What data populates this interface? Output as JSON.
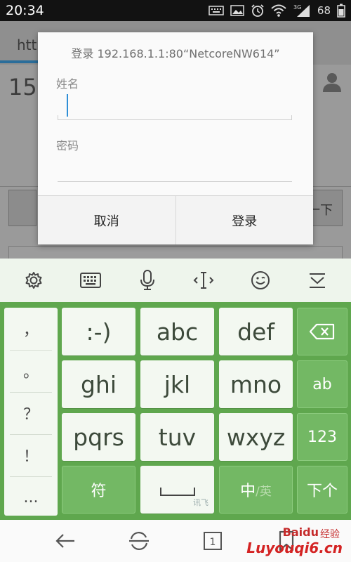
{
  "status_bar": {
    "time": "20:34",
    "battery": "68",
    "network_label": "3G",
    "icons": [
      "keyboard-icon",
      "image-icon",
      "alarm-icon",
      "wifi-icon",
      "signal-icon",
      "battery-icon"
    ]
  },
  "background_page": {
    "tab_text": "http",
    "number_text": "15",
    "button_text": "一下"
  },
  "dialog": {
    "title": "登录 192.168.1.1:80“NetcoreNW614”",
    "name_label": "姓名",
    "name_value": "",
    "password_label": "密码",
    "password_value": "",
    "cancel_label": "取消",
    "login_label": "登录"
  },
  "keyboard_toolbar": {
    "icons": [
      "settings-icon",
      "keyboard-icon",
      "microphone-icon",
      "cursor-icon",
      "emoji-icon",
      "hide-keyboard-icon"
    ]
  },
  "keyboard": {
    "symbols": [
      "，",
      "。",
      "？",
      "！",
      "..."
    ],
    "keys": {
      "smiley": ":-)",
      "abc": "abc",
      "def": "def",
      "ghi": "ghi",
      "jkl": "jkl",
      "mno": "mno",
      "pqrs": "pqrs",
      "tuv": "tuv",
      "wxyz": "wxyz",
      "ab": "ab",
      "num": "123",
      "symbol": "符",
      "cn": "中",
      "en": "英",
      "next": "下个",
      "space_brand": "讯飞"
    }
  },
  "nav_bar": {
    "icons": [
      "back-icon",
      "refresh-icon",
      "tabs-icon",
      "bookmark-icon"
    ],
    "tab_count": "1"
  },
  "watermark": {
    "baidu": "Baidu",
    "jingyan": "经验",
    "site": "Luyouqi6.cn"
  },
  "colors": {
    "keyboard_green": "#5fa74e",
    "accent_blue": "#2f8fd6"
  }
}
